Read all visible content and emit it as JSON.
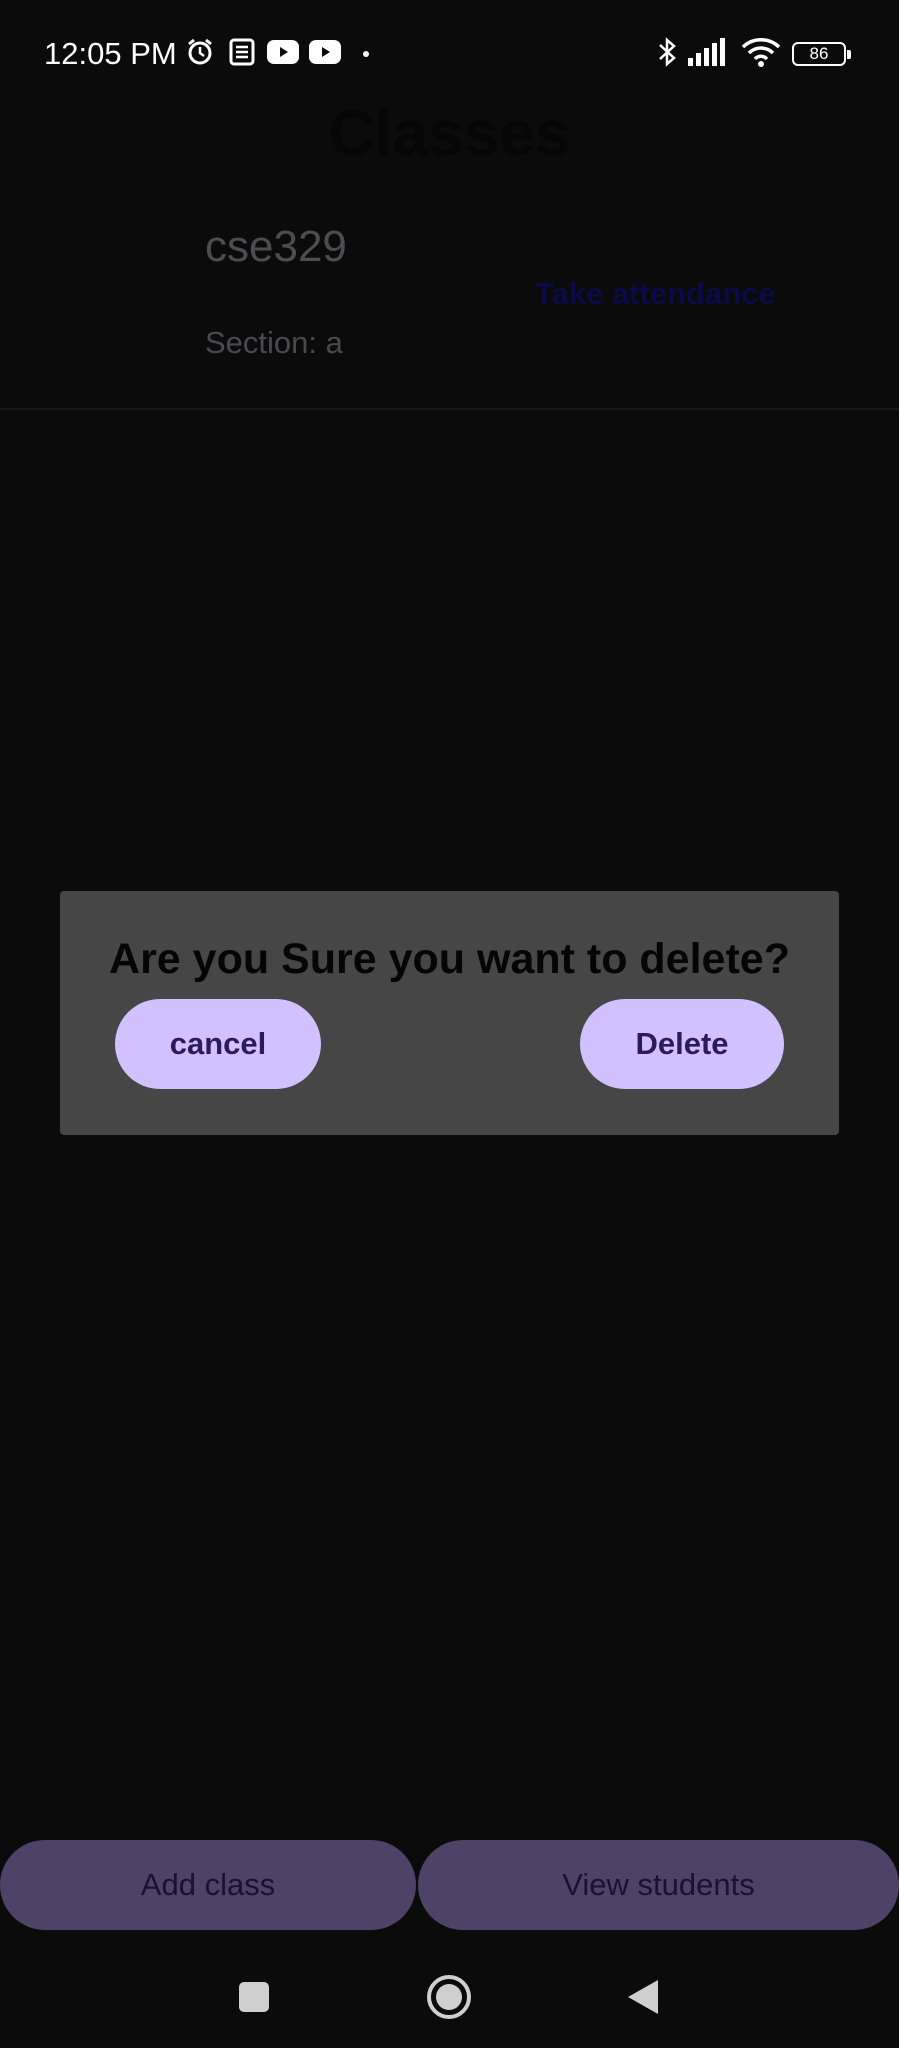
{
  "status_bar": {
    "time": "12:05 PM",
    "battery": "86",
    "icons": [
      "alarm-icon",
      "news-icon",
      "youtube-icon",
      "youtube-icon",
      "bluetooth-icon",
      "signal-icon",
      "wifi-icon",
      "battery-icon"
    ]
  },
  "page": {
    "title": "Classes"
  },
  "class_card": {
    "name": "cse329",
    "section": "Section: a",
    "take_attendance_label": "Take attendance"
  },
  "dialog": {
    "message": "Are you Sure you want to delete?",
    "cancel_label": "cancel",
    "delete_label": "Delete"
  },
  "bottom_buttons": {
    "add_class_label": "Add class",
    "view_students_label": "View students"
  },
  "navbar": {
    "icons": [
      "recents-icon",
      "home-icon",
      "back-icon"
    ]
  },
  "colors": {
    "background": "#0b0b0c",
    "dialog": "#464646",
    "dialog_button": "#d1c2ff",
    "bottom_button": "#4e4366"
  }
}
